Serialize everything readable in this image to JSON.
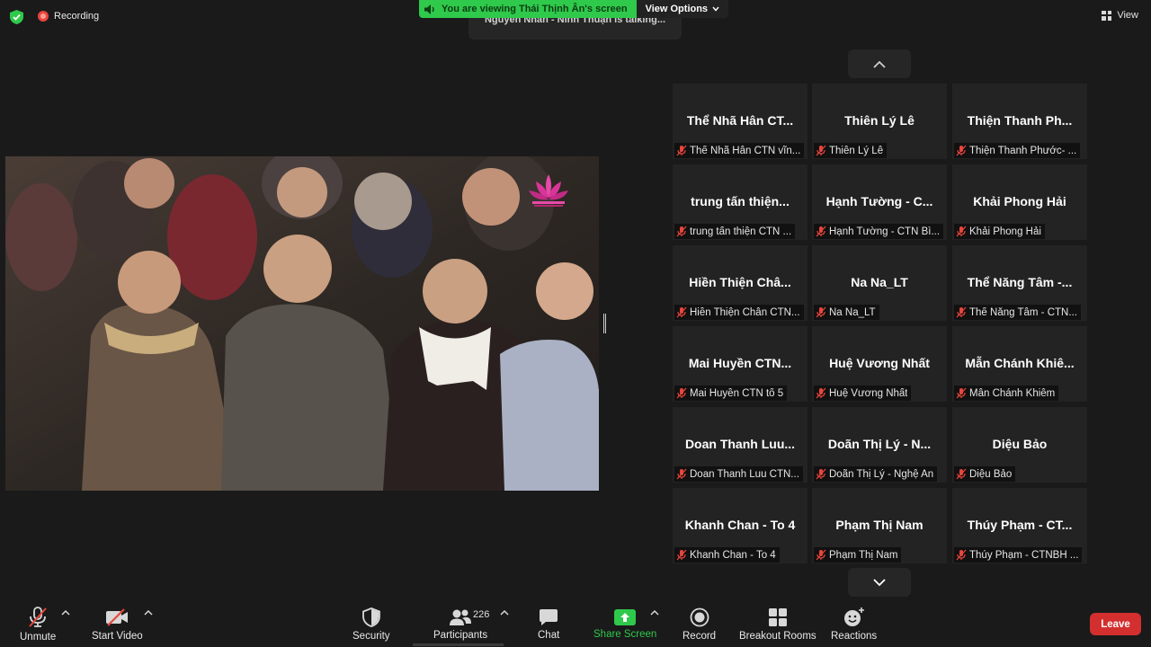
{
  "header": {
    "recording_label": "Recording",
    "view_label": "View",
    "talking": "Nguyễn Nhân - Ninh Thuận is talking...",
    "share_banner": "You are viewing Thái Thịnh Ân's screen",
    "view_options": "View Options"
  },
  "gallery": {
    "tiles": [
      {
        "name": "Thể Nhã Hân CT...",
        "label": "Thể Nhã Hân CTN vĩn..."
      },
      {
        "name": "Thiên Lý Lê",
        "label": "Thiên Lý Lê"
      },
      {
        "name": "Thiện Thanh Ph...",
        "label": "Thiện Thanh Phước- ..."
      },
      {
        "name": "trung tấn thiện...",
        "label": "trung tấn thiện CTN ..."
      },
      {
        "name": "Hạnh Tường - C...",
        "label": "Hạnh Tường - CTN Bì..."
      },
      {
        "name": "Khải Phong Hải",
        "label": "Khải Phong Hải"
      },
      {
        "name": "Hiền Thiện Châ...",
        "label": "Hiền Thiện Chân CTN..."
      },
      {
        "name": "Na Na_LT",
        "label": "Na Na_LT"
      },
      {
        "name": "Thể Năng Tâm -...",
        "label": "Thể Năng Tâm - CTN..."
      },
      {
        "name": "Mai Huyền CTN...",
        "label": "Mai Huyền CTN tổ 5"
      },
      {
        "name": "Huệ Vương Nhất",
        "label": "Huệ Vương Nhất"
      },
      {
        "name": "Mẫn Chánh Khiê...",
        "label": "Mẫn Chánh Khiêm"
      },
      {
        "name": "Doan Thanh Luu...",
        "label": "Doan Thanh Luu CTN..."
      },
      {
        "name": "Doãn Thị Lý - N...",
        "label": "Doãn Thị Lý - Nghệ An"
      },
      {
        "name": "Diệu Bảo",
        "label": "Diệu Bảo"
      },
      {
        "name": "Khanh Chan - To 4",
        "label": "Khanh Chan - To 4"
      },
      {
        "name": "Phạm Thị Nam",
        "label": "Phạm Thị Nam"
      },
      {
        "name": "Thúy Phạm - CT...",
        "label": "Thúy Phạm - CTNBH ..."
      }
    ]
  },
  "toolbar": {
    "unmute": "Unmute",
    "start_video": "Start Video",
    "security": "Security",
    "participants": "Participants",
    "participant_count": "226",
    "chat": "Chat",
    "share_screen": "Share Screen",
    "record": "Record",
    "breakout_rooms": "Breakout Rooms",
    "reactions": "Reactions",
    "leave": "Leave"
  },
  "colors": {
    "background": "#1a1a1a",
    "tile": "#232323",
    "share_green": "#2fc94b",
    "leave_red": "#d32f2f",
    "mute_red": "#e8453c"
  }
}
